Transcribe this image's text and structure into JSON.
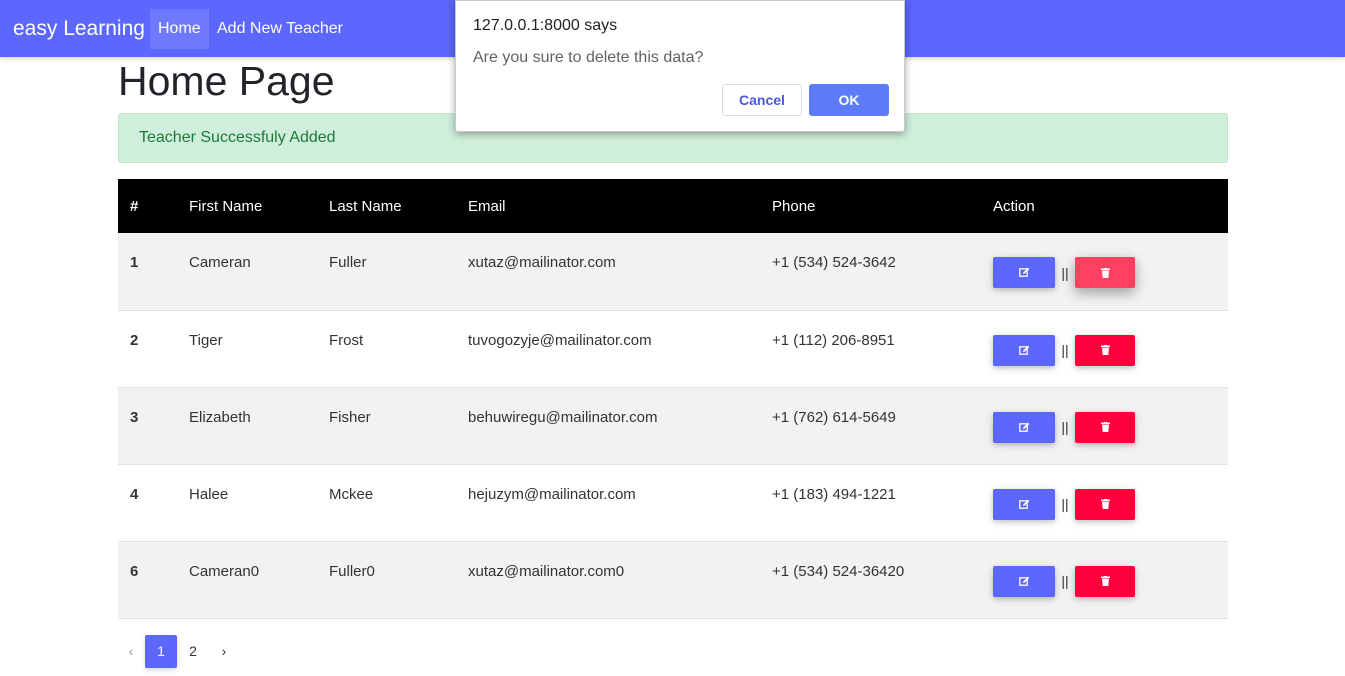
{
  "navbar": {
    "brand": "easy Learning",
    "links": [
      "Home",
      "Add New Teacher"
    ]
  },
  "page": {
    "title": "Home Page",
    "alert": "Teacher Successfuly Added"
  },
  "table": {
    "headers": [
      "#",
      "First Name",
      "Last Name",
      "Email",
      "Phone",
      "Action"
    ],
    "separator": "||",
    "rows": [
      {
        "num": "1",
        "first": "Cameran",
        "last": "Fuller",
        "email": "xutaz@mailinator.com",
        "phone": "+1 (534) 524-3642"
      },
      {
        "num": "2",
        "first": "Tiger",
        "last": "Frost",
        "email": "tuvogozyje@mailinator.com",
        "phone": "+1 (112) 206-8951"
      },
      {
        "num": "3",
        "first": "Elizabeth",
        "last": "Fisher",
        "email": "behuwiregu@mailinator.com",
        "phone": "+1 (762) 614-5649"
      },
      {
        "num": "4",
        "first": "Halee",
        "last": "Mckee",
        "email": "hejuzym@mailinator.com",
        "phone": "+1 (183) 494-1221"
      },
      {
        "num": "6",
        "first": "Cameran0",
        "last": "Fuller0",
        "email": "xutaz@mailinator.com0",
        "phone": "+1 (534) 524-36420"
      }
    ]
  },
  "pagination": {
    "prev": "‹",
    "pages": [
      "1",
      "2"
    ],
    "active": "1",
    "next": "›"
  },
  "dialog": {
    "title": "127.0.0.1:8000 says",
    "message": "Are you sure to delete this data?",
    "cancel": "Cancel",
    "ok": "OK"
  },
  "icons": {
    "edit": "edit-icon",
    "delete": "trash-icon"
  },
  "colors": {
    "primary": "#5c67fd",
    "danger": "#ff003c",
    "alert_bg": "#cfeedc",
    "alert_text": "#1e7a3a"
  }
}
